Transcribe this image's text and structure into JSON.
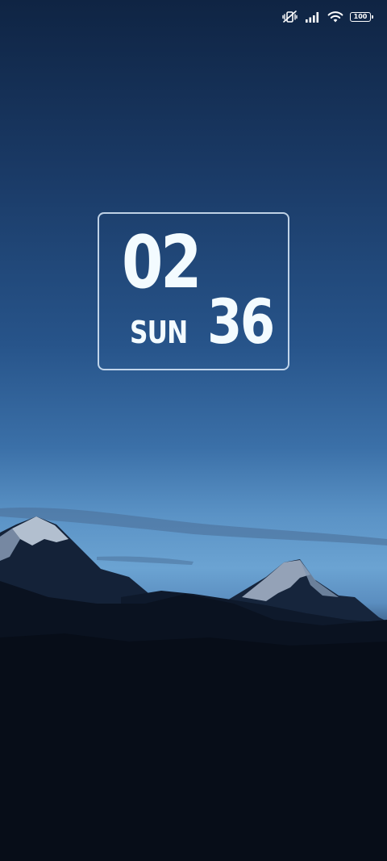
{
  "status_bar": {
    "icons": [
      "vibrate-silent-icon",
      "signal-icon",
      "wifi-icon",
      "battery-icon"
    ],
    "battery_level": "100"
  },
  "clock": {
    "hour": "02",
    "minute": "36",
    "day": "SUN"
  },
  "wallpaper": {
    "subject": "mountain-silhouette-at-dusk",
    "colors": {
      "sky_top": "#0f2443",
      "sky_horizon": "#6ba3d2",
      "mountain": "#0c1628",
      "snow": "#c9d6e6"
    }
  }
}
